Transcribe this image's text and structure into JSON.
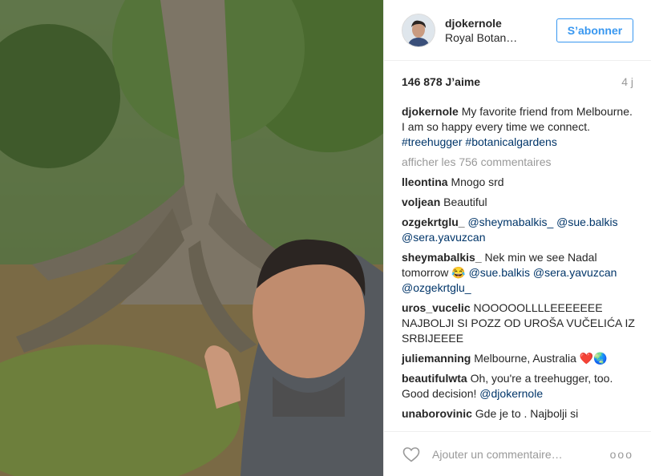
{
  "post": {
    "username": "djokernole",
    "location": "Royal Botanic Gardens",
    "follow_label": "S’abonner",
    "likes": "146 878 J’aime",
    "age": "4 j",
    "caption": {
      "user": "djokernole",
      "text": "My favorite friend from Melbourne. I am so happy every time we connect.",
      "tags": [
        "#treehugger",
        "#botanicalgardens"
      ]
    },
    "view_all": "afficher les 756 commentaires",
    "comments": [
      {
        "user": "lleontina",
        "text": "Mnogo srd"
      },
      {
        "user": "voljean",
        "text": "Beautiful"
      },
      {
        "user": "ozgekrtglu_",
        "text": "",
        "mentions": [
          "@sheymabalkis_",
          "@sue.balkis",
          "@sera.yavuzcan"
        ]
      },
      {
        "user": "sheymabalkis_",
        "text": "Nek min we see Nadal tomorrow 😂",
        "mentions": [
          "@sue.balkis",
          "@sera.yavuzcan",
          "@ozgekrtglu_"
        ]
      },
      {
        "user": "uros_vucelic",
        "text": "NOOOOOLLLLEEEEEEE NAJBOLJI SI POZZ OD UROŠA VUČELIĆA IZ SRBIJEEEE"
      },
      {
        "user": "juliemanning",
        "text": "Melbourne, Australia ❤️🌏"
      },
      {
        "user": "beautifulwta",
        "text": "Oh, you're a treehugger, too. Good decision!",
        "mentions": [
          "@djokernole"
        ]
      },
      {
        "user": "unaborovinic",
        "text": "Gde je to . Najbolji si"
      }
    ],
    "add_comment_placeholder": "Ajouter un commentaire…",
    "more_options": "ooo"
  },
  "icons": {
    "heart": "heart-outline-icon",
    "more": "more-options-icon"
  },
  "colors": {
    "link": "#003569",
    "follow_blue": "#3897f0",
    "muted": "#999999"
  }
}
